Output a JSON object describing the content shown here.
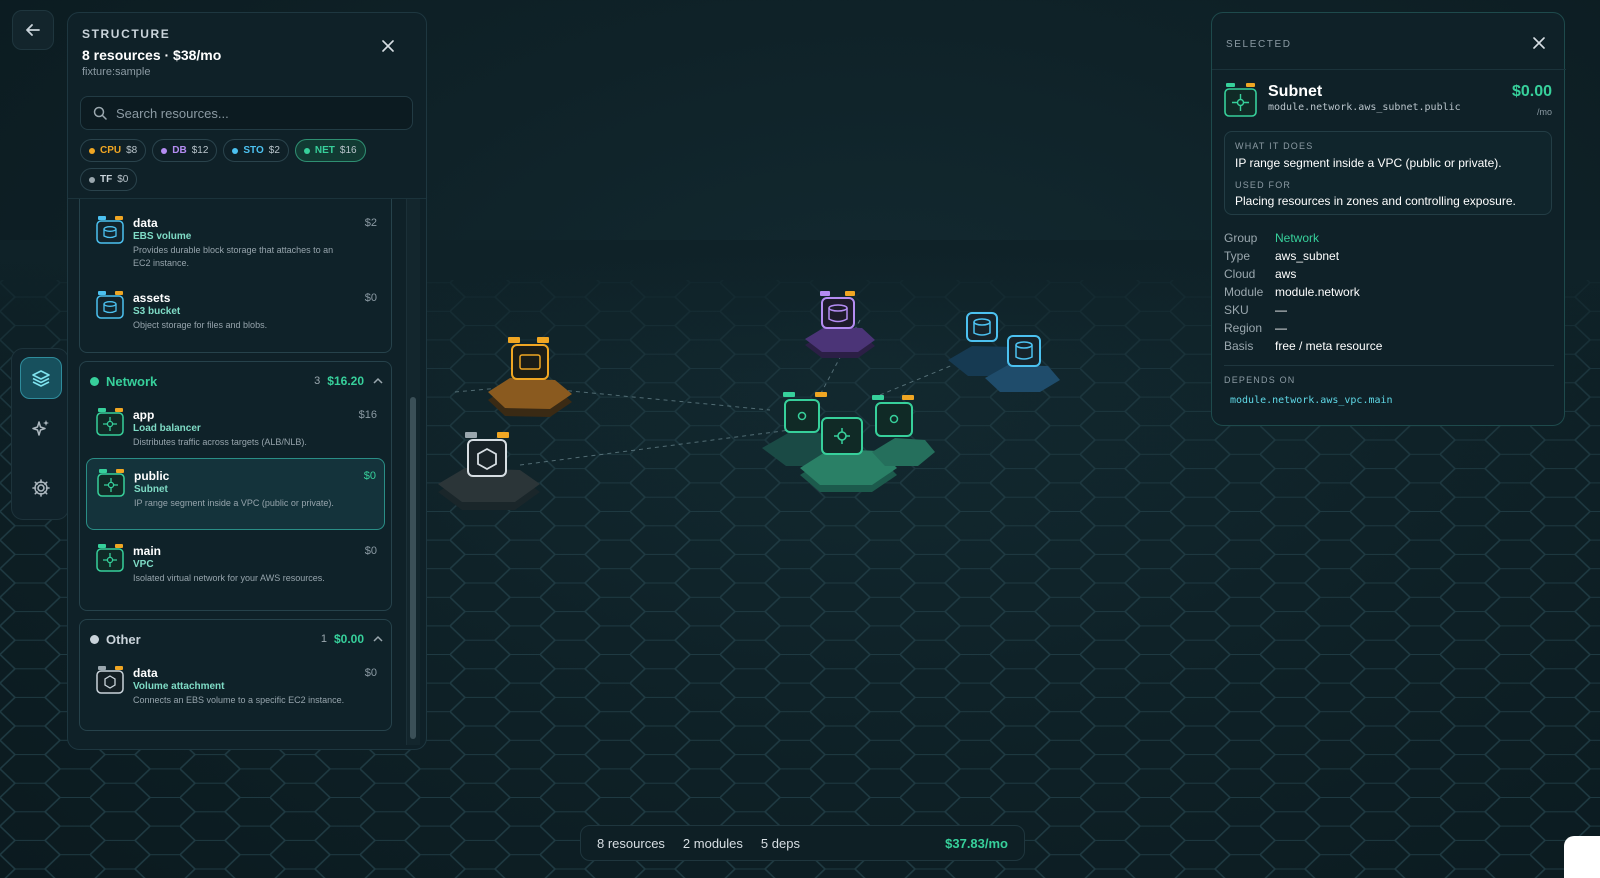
{
  "colors": {
    "accent": "#37d09b",
    "cpu": "#f0a623",
    "db": "#b48cf2",
    "sto": "#4cc1f0",
    "net": "#37d09b",
    "tf": "#9aa7ae"
  },
  "structure": {
    "eyebrow": "STRUCTURE",
    "title": "8 resources · $38/mo",
    "subtitle": "fixture:sample",
    "search_placeholder": "Search resources...",
    "chips": [
      {
        "key": "CPU",
        "value": "$8",
        "color": "#f0a623"
      },
      {
        "key": "DB",
        "value": "$12",
        "color": "#b48cf2"
      },
      {
        "key": "STO",
        "value": "$2",
        "color": "#4cc1f0"
      },
      {
        "key": "NET",
        "value": "$16",
        "color": "#37d09b"
      },
      {
        "key": "TF",
        "value": "$0",
        "color": "#9aa7ae"
      }
    ],
    "storage_items": [
      {
        "name": "data",
        "type": "EBS volume",
        "desc": "Provides durable block storage that attaches to an EC2 instance.",
        "cost": "$2",
        "icon": "storage-icon"
      },
      {
        "name": "assets",
        "type": "S3 bucket",
        "desc": "Object storage for files and blobs.",
        "cost": "$0",
        "icon": "storage-icon"
      }
    ],
    "network": {
      "name": "Network",
      "count": "3",
      "cost": "$16.20",
      "items": [
        {
          "name": "app",
          "type": "Load balancer",
          "desc": "Distributes traffic across targets (ALB/NLB).",
          "cost": "$16",
          "icon": "network-icon"
        },
        {
          "name": "public",
          "type": "Subnet",
          "desc": "IP range segment inside a VPC (public or private).",
          "cost": "$0",
          "icon": "network-icon"
        },
        {
          "name": "main",
          "type": "VPC",
          "desc": "Isolated virtual network for your AWS resources.",
          "cost": "$0",
          "icon": "network-icon"
        }
      ]
    },
    "other": {
      "name": "Other",
      "count": "1",
      "cost": "$0.00",
      "items": [
        {
          "name": "data",
          "type": "Volume attachment",
          "desc": "Connects an EBS volume to a specific EC2 instance.",
          "cost": "$0",
          "icon": "hexagon-icon"
        }
      ]
    }
  },
  "selected": {
    "eyebrow": "SELECTED",
    "name": "Subnet",
    "address": "module.network.aws_subnet.public",
    "cost": "$0.00",
    "per": "/mo",
    "what_label": "WHAT IT DOES",
    "what": "IP range segment inside a VPC (public or private).",
    "used_label": "USED FOR",
    "used": "Placing resources in zones and controlling exposure.",
    "props": [
      {
        "key": "Group",
        "value": "Network"
      },
      {
        "key": "Type",
        "value": "aws_subnet"
      },
      {
        "key": "Cloud",
        "value": "aws"
      },
      {
        "key": "Module",
        "value": "module.network"
      },
      {
        "key": "SKU",
        "value": "—"
      },
      {
        "key": "Region",
        "value": "—"
      },
      {
        "key": "Basis",
        "value": "free / meta resource"
      }
    ],
    "depends_label": "DEPENDS ON",
    "depends": "module.network.aws_vpc.main"
  },
  "status": {
    "resources": "8 resources",
    "modules": "2 modules",
    "deps": "5 deps",
    "total": "$37.83/mo"
  },
  "scene": {
    "tags": [
      "CPU",
      "AWS",
      "DB",
      "STO",
      "NET",
      "TF"
    ]
  }
}
